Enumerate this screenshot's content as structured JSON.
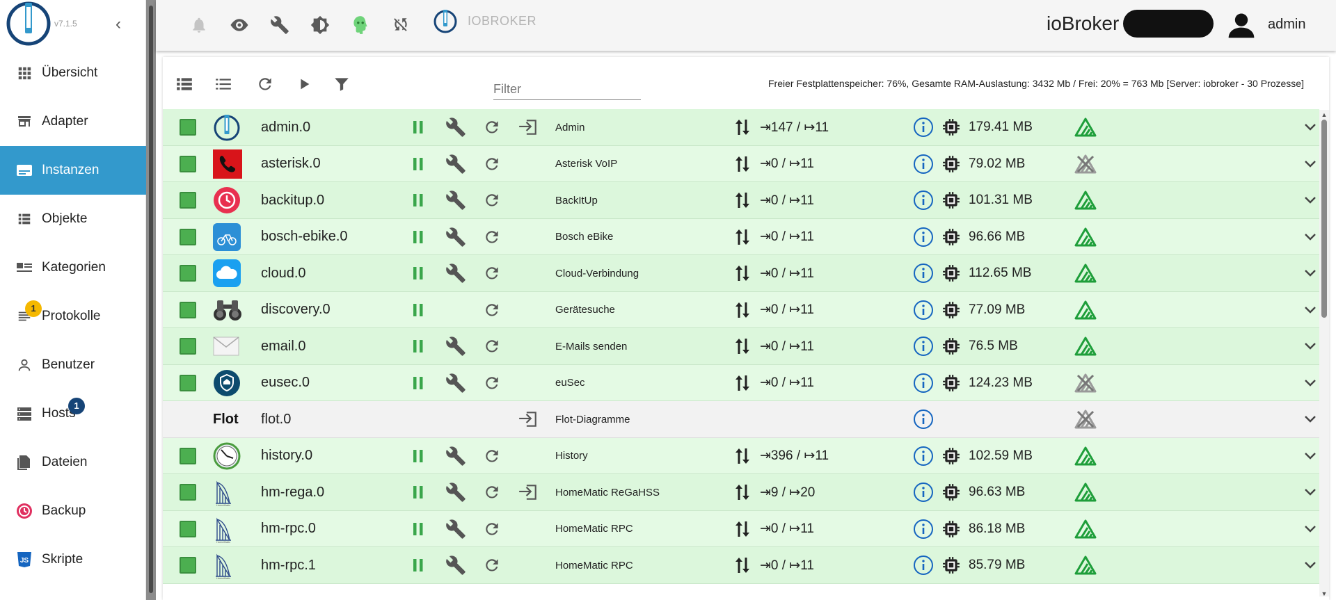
{
  "app": {
    "version": "v7.1.5",
    "brand": "IOBROKER",
    "host_label": "ioBroker",
    "user": "admin"
  },
  "colors": {
    "accent": "#3399cc",
    "row_green": "#dcf7dc",
    "ok_green": "#4caf50",
    "signal_green": "#1e9e3a",
    "info_blue": "#1565c0"
  },
  "sidebar": {
    "items": [
      {
        "label": "Übersicht",
        "icon": "apps-grid-icon"
      },
      {
        "label": "Adapter",
        "icon": "store-icon"
      },
      {
        "label": "Instanzen",
        "icon": "instances-icon",
        "active": true
      },
      {
        "label": "Objekte",
        "icon": "list-icon"
      },
      {
        "label": "Kategorien",
        "icon": "category-icon"
      },
      {
        "label": "Protokolle",
        "icon": "log-icon",
        "badge": "1"
      },
      {
        "label": "Benutzer",
        "icon": "user-icon"
      },
      {
        "label": "Hosts",
        "icon": "hosts-icon",
        "badge": "1"
      },
      {
        "label": "Dateien",
        "icon": "files-icon"
      },
      {
        "label": "Backup",
        "icon": "backup-icon"
      },
      {
        "label": "Skripte",
        "icon": "js-icon"
      }
    ]
  },
  "toolbar": {
    "filter_placeholder": "Filter",
    "status": "Freier Festplattenspeicher: 76%, Gesamte RAM-Auslastung: 3432 Mb / Frei: 20% = 763 Mb [Server: iobroker - 30 Prozesse]"
  },
  "instances": [
    {
      "name": "admin.0",
      "title": "Admin",
      "io": "⇥147 / ↦11",
      "mem": "179.41 MB",
      "enabled": true,
      "config": true,
      "login": true,
      "connected": true,
      "icon": "admin-icon"
    },
    {
      "name": "asterisk.0",
      "title": "Asterisk VoIP",
      "io": "⇥0 / ↦11",
      "mem": "79.02 MB",
      "enabled": true,
      "config": true,
      "login": false,
      "connected": false,
      "icon": "asterisk-icon"
    },
    {
      "name": "backitup.0",
      "title": "BackItUp",
      "io": "⇥0 / ↦11",
      "mem": "101.31 MB",
      "enabled": true,
      "config": true,
      "login": false,
      "connected": true,
      "icon": "backitup-icon"
    },
    {
      "name": "bosch-ebike.0",
      "title": "Bosch eBike",
      "io": "⇥0 / ↦11",
      "mem": "96.66 MB",
      "enabled": true,
      "config": true,
      "login": false,
      "connected": true,
      "icon": "ebike-icon"
    },
    {
      "name": "cloud.0",
      "title": "Cloud-Verbindung",
      "io": "⇥0 / ↦11",
      "mem": "112.65 MB",
      "enabled": true,
      "config": true,
      "login": false,
      "connected": true,
      "icon": "cloud-icon"
    },
    {
      "name": "discovery.0",
      "title": "Gerätesuche",
      "io": "⇥0 / ↦11",
      "mem": "77.09 MB",
      "enabled": true,
      "config": false,
      "login": false,
      "connected": true,
      "icon": "binoculars-icon"
    },
    {
      "name": "email.0",
      "title": "E-Mails senden",
      "io": "⇥0 / ↦11",
      "mem": "76.5 MB",
      "enabled": true,
      "config": true,
      "login": false,
      "connected": true,
      "icon": "envelope-icon"
    },
    {
      "name": "eusec.0",
      "title": "euSec",
      "io": "⇥0 / ↦11",
      "mem": "124.23 MB",
      "enabled": true,
      "config": true,
      "login": false,
      "connected": false,
      "icon": "eusec-icon"
    },
    {
      "name": "flot.0",
      "title": "Flot-Diagramme",
      "io": "",
      "mem": "",
      "enabled": false,
      "config": false,
      "login": true,
      "connected": false,
      "icon": "flot-icon",
      "icon_text": "Flot"
    },
    {
      "name": "history.0",
      "title": "History",
      "io": "⇥396 / ↦11",
      "mem": "102.59 MB",
      "enabled": true,
      "config": true,
      "login": false,
      "connected": true,
      "icon": "history-clock-icon"
    },
    {
      "name": "hm-rega.0",
      "title": "HomeMatic ReGaHSS",
      "io": "⇥9 / ↦20",
      "mem": "96.63 MB",
      "enabled": true,
      "config": true,
      "login": true,
      "connected": true,
      "icon": "homematic-icon"
    },
    {
      "name": "hm-rpc.0",
      "title": "HomeMatic RPC",
      "io": "⇥0 / ↦11",
      "mem": "86.18 MB",
      "enabled": true,
      "config": true,
      "login": false,
      "connected": true,
      "icon": "homematic-icon"
    },
    {
      "name": "hm-rpc.1",
      "title": "HomeMatic RPC",
      "io": "⇥0 / ↦11",
      "mem": "85.79 MB",
      "enabled": true,
      "config": true,
      "login": false,
      "connected": true,
      "icon": "homematic-icon"
    }
  ]
}
